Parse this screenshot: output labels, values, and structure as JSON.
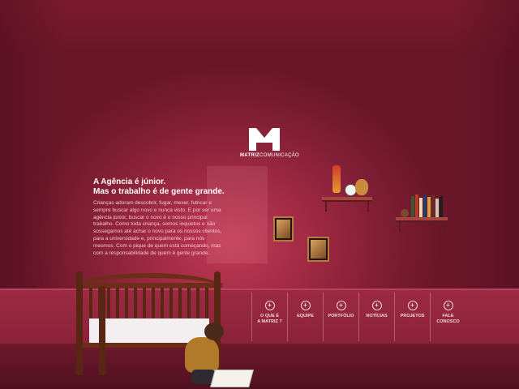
{
  "logo": {
    "brand_bold": "MATRIZ",
    "brand_light": "COMUNICAÇÃO"
  },
  "headline": {
    "line1": "A Agência é júnior.",
    "line2": "Mas o trabalho é de gente grande."
  },
  "intro_text": "Crianças adoram descobrir, fugar, mexer, futricar e sempre buscar algo novo e nunca visto. E por ser uma agência júnior, buscar o novo é o nosso principal trabalho. Como toda criança, somos inquietos e não sossegamos até achar o novo para os nossos clientes, para a universidade e, principalmente, para nós mesmos. Com o pique de quem está começando, mas com a responsabilidade de quem é gente grande.",
  "nav": {
    "items": [
      {
        "label": "O QUE É\nA MATRIZ ?",
        "icon": "plus-circle-icon"
      },
      {
        "label": "EQUIPE",
        "icon": "plus-circle-icon"
      },
      {
        "label": "PORTFÓLIO",
        "icon": "plus-circle-icon"
      },
      {
        "label": "NOTÍCIAS",
        "icon": "plus-circle-icon"
      },
      {
        "label": "PROJETOS",
        "icon": "plus-circle-icon"
      },
      {
        "label": "FALE\nCONOSCO",
        "icon": "plus-circle-icon"
      }
    ],
    "plus_glyph": "+"
  },
  "colors": {
    "wall": "#9a2740",
    "text_light": "#f3d6dc",
    "logo": "#ffffff"
  }
}
